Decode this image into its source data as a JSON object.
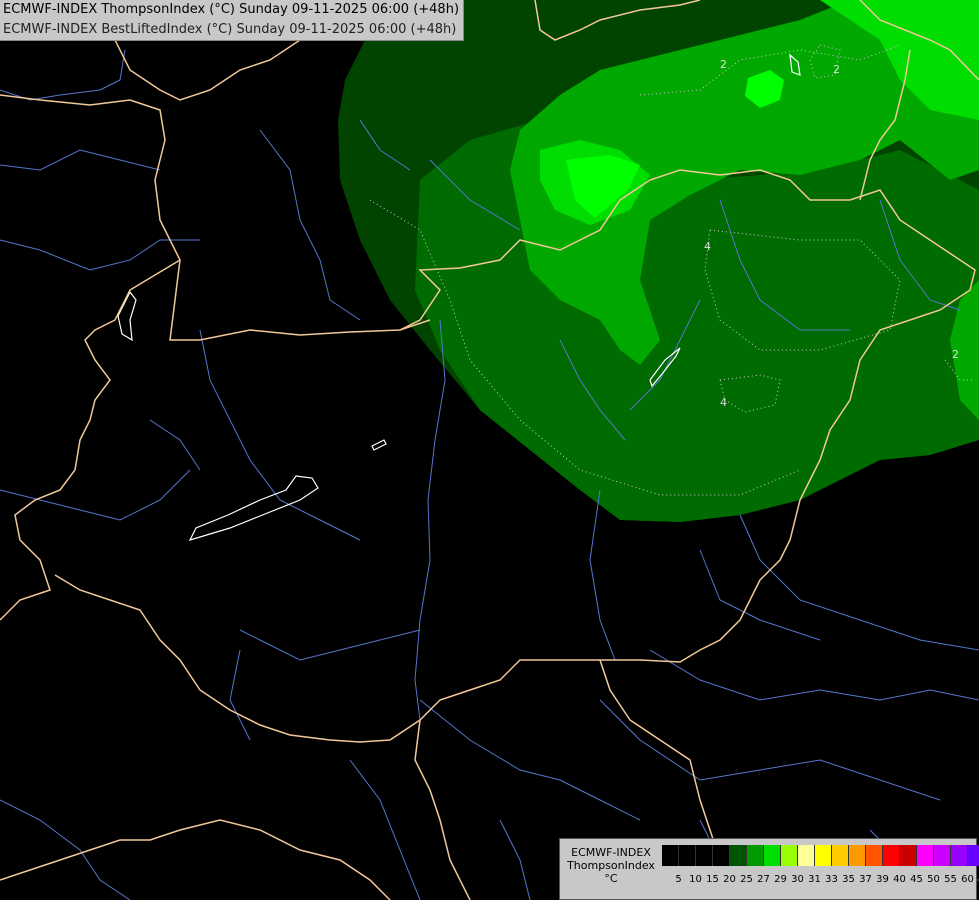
{
  "title": {
    "line1": "ECMWF-INDEX ThompsonIndex (°C) Sunday 09-11-2025 06:00 (+48h)",
    "line2": "ECMWF-INDEX BestLiftedIndex (°C) Sunday 09-11-2025 06:00 (+48h)"
  },
  "colors": {
    "background": "#000000",
    "border": "#f3c898",
    "river": "#5577cc",
    "zone_dark": "#004400",
    "zone_mid": "#006b00",
    "zone_light": "#00a800",
    "zone_bright": "#00dd00",
    "zone_neon": "#00ff00"
  },
  "contour_labels": [
    "2",
    "2",
    "4",
    "4",
    "2"
  ],
  "legend": {
    "line1": "ECMWF-INDEX",
    "line2": "ThompsonIndex",
    "unit": "°C",
    "colors": [
      "#000000",
      "#000000",
      "#000000",
      "#000000",
      "#005500",
      "#009900",
      "#00dd00",
      "#99ff00",
      "#ffff99",
      "#ffff00",
      "#ffcc00",
      "#ff9900",
      "#ff5500",
      "#ff0000",
      "#cc0000",
      "#ff00ff",
      "#cc00ff",
      "#9900ff",
      "#6600ff",
      "#0000ff"
    ],
    "ticks": [
      "5",
      "10",
      "15",
      "20",
      "25",
      "27",
      "29",
      "30",
      "31",
      "33",
      "35",
      "37",
      "39",
      "40",
      "45",
      "50",
      "55",
      "60"
    ]
  }
}
